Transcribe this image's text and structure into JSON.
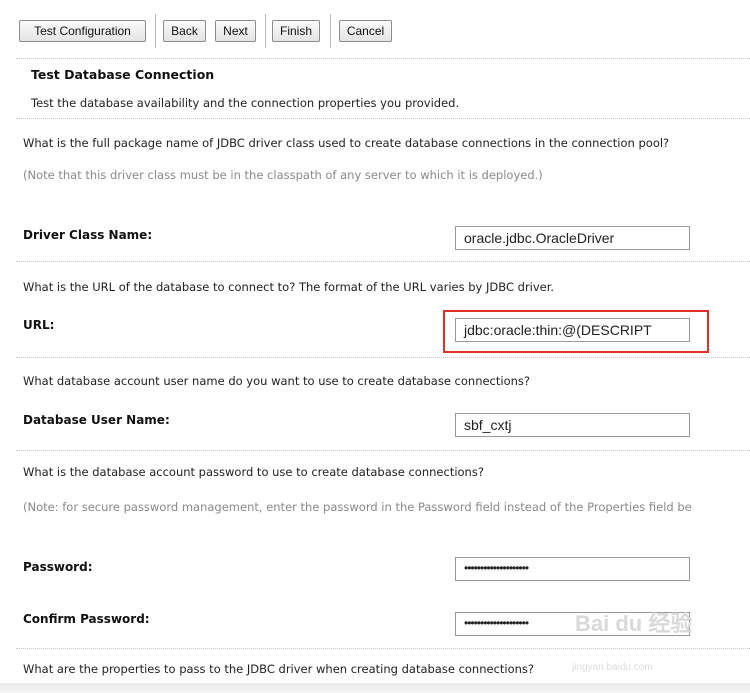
{
  "toolbar": {
    "test_configuration": "Test Configuration",
    "back": "Back",
    "next": "Next",
    "finish": "Finish",
    "cancel": "Cancel"
  },
  "section": {
    "title": "Test Database Connection",
    "description": "Test the database availability and the connection properties you provided."
  },
  "driver": {
    "question": "What is the full package name of JDBC driver class used to create database connections in the connection pool?",
    "note": "(Note that this driver class must be in the classpath of any server to which it is deployed.)",
    "label": "Driver Class Name:",
    "value": "oracle.jdbc.OracleDriver"
  },
  "url": {
    "question": "What is the URL of the database to connect to? The format of the URL varies by JDBC driver.",
    "label": "URL:",
    "value": "jdbc:oracle:thin:@(DESCRIPT"
  },
  "user": {
    "question": "What database account user name do you want to use to create database connections?",
    "label": "Database User Name:",
    "value": "sbf_cxtj"
  },
  "password": {
    "question": "What is the database account password to use to create database connections?",
    "note": "(Note: for secure password management, enter the password in the Password field instead of the Properties field be",
    "label": "Password:",
    "value": "••••••••••••••••••••"
  },
  "confirm_password": {
    "label": "Confirm Password:",
    "value": "••••••••••••••••••••"
  },
  "properties": {
    "question": "What are the properties to pass to the JDBC driver when creating database connections?"
  },
  "watermark": {
    "logo": "Bai du 经验",
    "site": "jingyan.baidu.com"
  },
  "colors": {
    "highlight": "#e0302a",
    "note_text": "#8a8a8a"
  }
}
